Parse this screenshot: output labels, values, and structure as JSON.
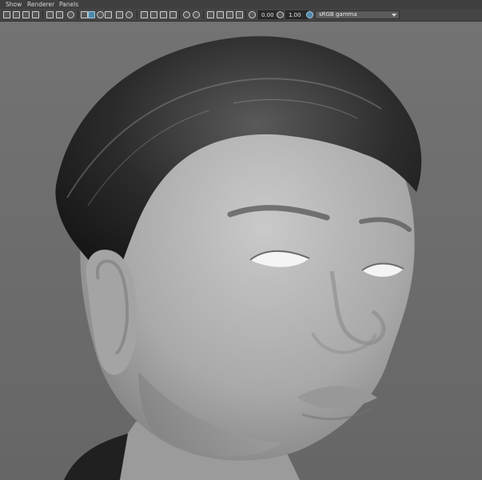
{
  "menu": {
    "items": [
      {
        "label": "Show"
      },
      {
        "label": "Renderer"
      },
      {
        "label": "Panels"
      }
    ]
  },
  "toolbar": {
    "exposure_value": "0.00",
    "gamma_value": "1.00",
    "color_space": "sRGB gamma",
    "accent_color": "#4f88aa",
    "icons": [
      "grid-icon",
      "wireframe-icon",
      "smooth-shade-icon",
      "textured-icon",
      "lights-icon",
      "shadows-icon",
      "isolate-icon",
      "camera-icon",
      "sphere-icon",
      "sphere-light-icon",
      "select-icon",
      "copy-icon",
      "resolution-gate-icon",
      "exposure-icon",
      "gamma-icon",
      "color-management-icon"
    ]
  },
  "viewport": {
    "background_color": "#6f6f6f",
    "subject": "grayscale 3D render of a male head with dark hair"
  }
}
